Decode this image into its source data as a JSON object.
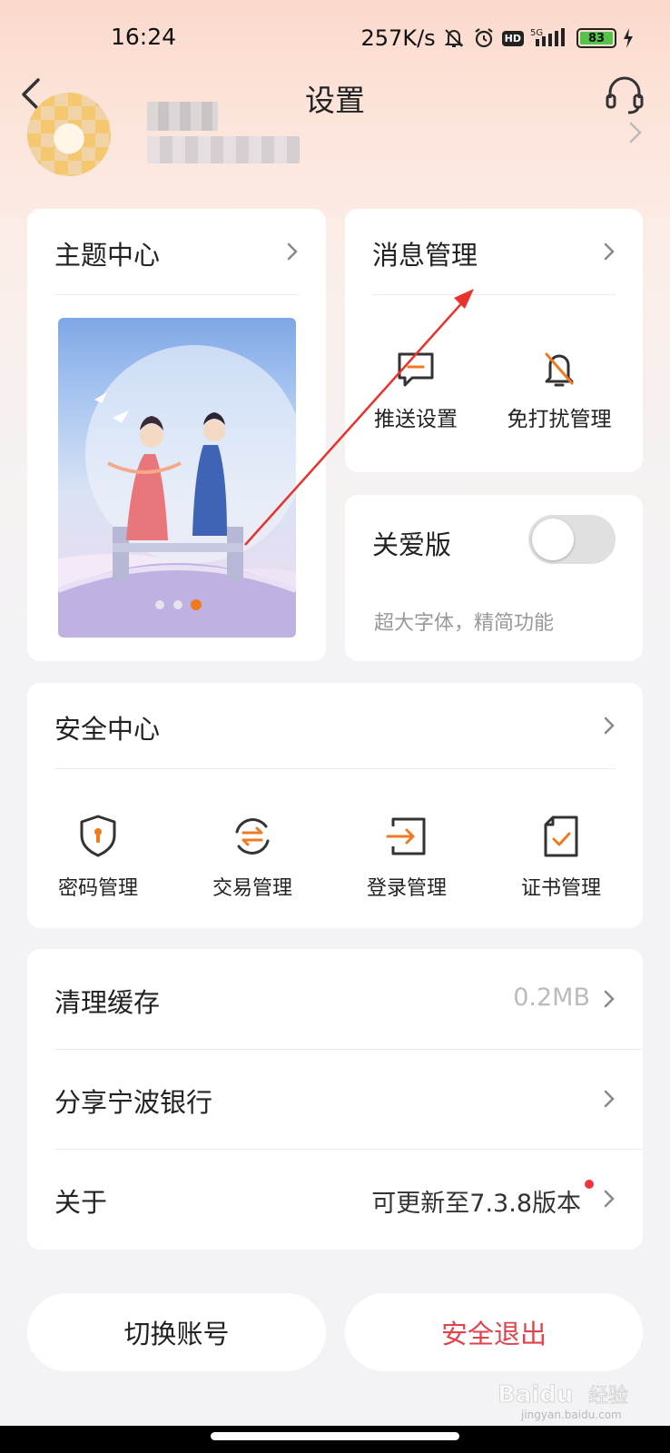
{
  "status_bar": {
    "time": "16:24",
    "speed": "257K/s",
    "hd": "HD",
    "network": "5G",
    "battery": "83"
  },
  "header": {
    "title": "设置"
  },
  "theme": {
    "title": "主题中心"
  },
  "message": {
    "title": "消息管理",
    "items": [
      {
        "label": "推送设置"
      },
      {
        "label": "免打扰管理"
      }
    ]
  },
  "care": {
    "title": "关爱版",
    "toggle_on": false,
    "description": "超大字体，精简功能"
  },
  "security": {
    "title": "安全中心",
    "items": [
      {
        "label": "密码管理"
      },
      {
        "label": "交易管理"
      },
      {
        "label": "登录管理"
      },
      {
        "label": "证书管理"
      }
    ]
  },
  "list": {
    "rows": [
      {
        "label": "清理缓存",
        "value": "0.2MB"
      },
      {
        "label": "分享宁波银行",
        "value": ""
      },
      {
        "label": "关于",
        "value": "可更新至7.3.8版本"
      }
    ]
  },
  "buttons": {
    "switch_account": "切换账号",
    "logout": "安全退出"
  },
  "colors": {
    "accent": "#f07a1e",
    "logout": "#e0434b",
    "annotation_arrow": "#e8322b"
  },
  "watermark": {
    "brand": "Baidu",
    "brand_cn": "经验",
    "site": "jingyan.baidu.com"
  }
}
